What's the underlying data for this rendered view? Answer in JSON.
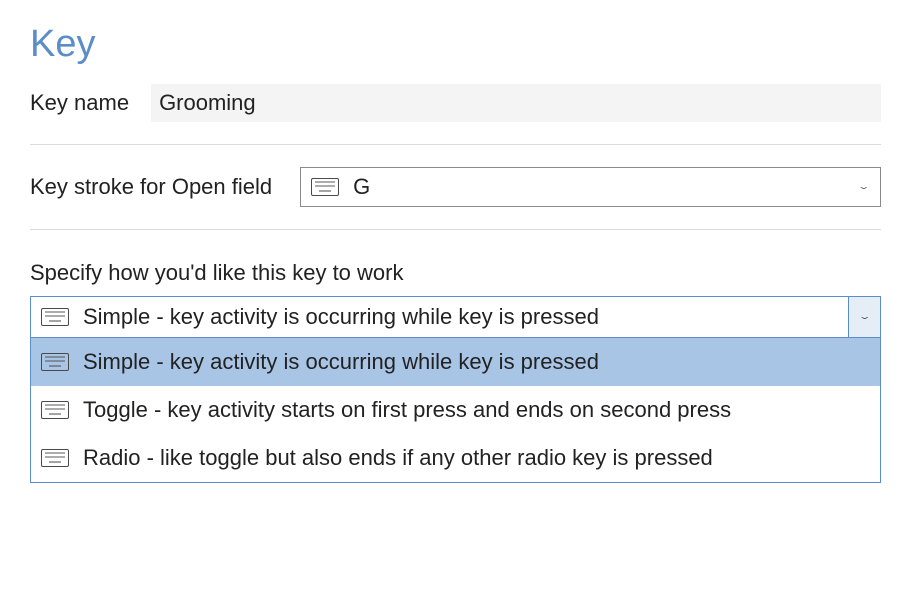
{
  "page_title": "Key",
  "key_name": {
    "label": "Key name",
    "value": "Grooming"
  },
  "keystroke": {
    "label": "Key stroke for Open field",
    "value": "G"
  },
  "behavior": {
    "instruction": "Specify how you'd like this key to work",
    "selected_label": "Simple - key activity is occurring while key is pressed",
    "options": [
      {
        "label": "Simple - key activity is occurring while key is pressed",
        "selected": true
      },
      {
        "label": "Toggle - key activity starts on first press and ends on second press",
        "selected": false
      },
      {
        "label": "Radio - like toggle but also ends if any other radio key is pressed",
        "selected": false
      }
    ]
  }
}
